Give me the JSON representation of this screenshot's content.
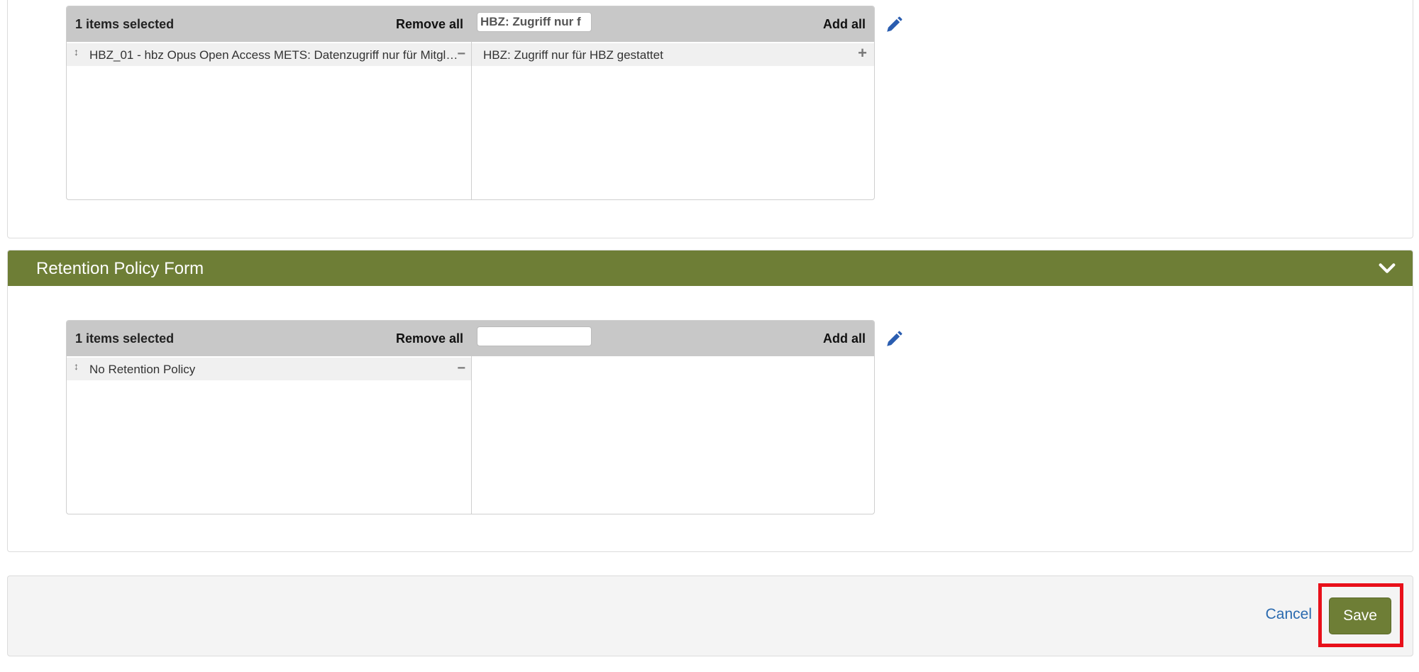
{
  "access_rights_picker": {
    "selected_count_label": "1 items selected",
    "remove_all_label": "Remove all",
    "add_all_label": "Add all",
    "filter_value": "HBZ: Zugriff nur f",
    "selected_items": [
      {
        "label": "HBZ_01 - hbz Opus Open Access METS: Datenzugriff nur für Mitglie..."
      }
    ],
    "available_items": [
      {
        "label": "HBZ: Zugriff nur für HBZ gestattet"
      }
    ]
  },
  "retention_policy_panel": {
    "title": "Retention Policy Form",
    "picker": {
      "selected_count_label": "1 items selected",
      "remove_all_label": "Remove all",
      "add_all_label": "Add all",
      "filter_value": "",
      "selected_items": [
        {
          "label": "No Retention Policy"
        }
      ],
      "available_items": []
    }
  },
  "footer": {
    "cancel_label": "Cancel",
    "save_label": "Save"
  },
  "colors": {
    "panel_header": "#6e7e36",
    "link": "#2a6aaf",
    "highlight": "#e8101a"
  }
}
